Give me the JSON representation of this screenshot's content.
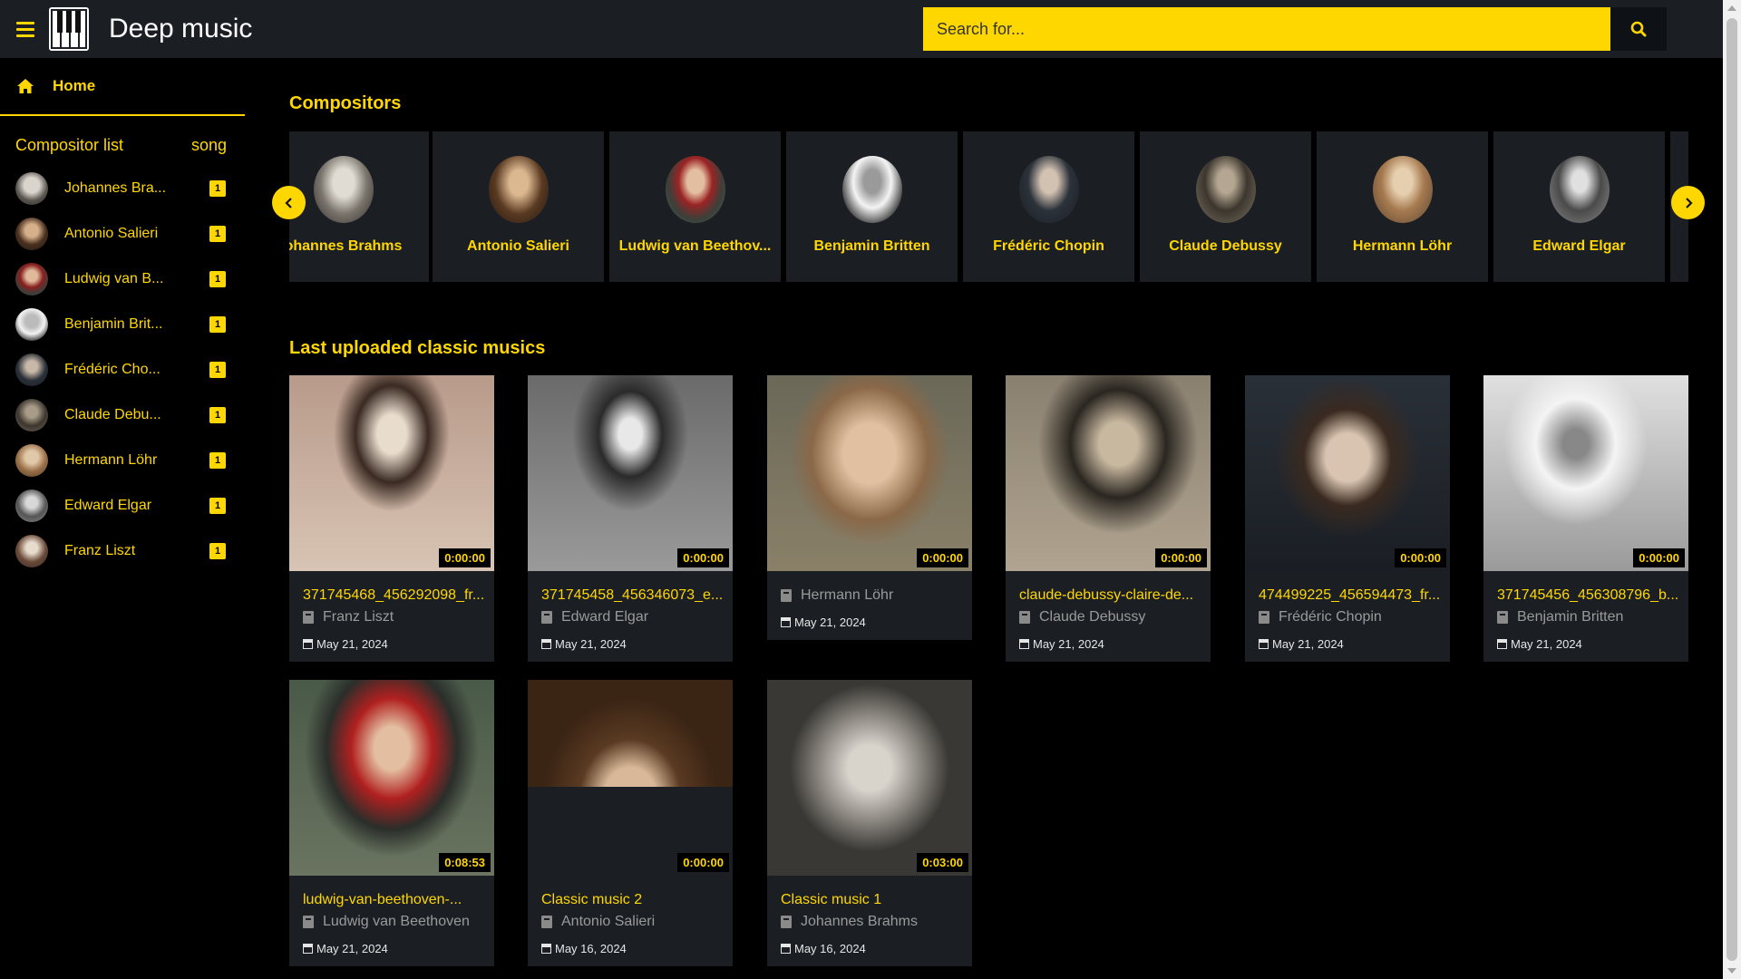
{
  "app": {
    "title": "Deep music"
  },
  "search": {
    "placeholder": "Search for..."
  },
  "sidebar": {
    "home_label": "Home",
    "list_title": "Compositor list",
    "count_title": "song",
    "items": [
      {
        "label": "Johannes Bra...",
        "count": "1"
      },
      {
        "label": "Antonio Salieri",
        "count": "1"
      },
      {
        "label": "Ludwig van B...",
        "count": "1"
      },
      {
        "label": "Benjamin Brit...",
        "count": "1"
      },
      {
        "label": "Frédéric Cho...",
        "count": "1"
      },
      {
        "label": "Claude Debu...",
        "count": "1"
      },
      {
        "label": "Hermann Löhr",
        "count": "1"
      },
      {
        "label": "Edward Elgar",
        "count": "1"
      },
      {
        "label": "Franz Liszt",
        "count": "1"
      }
    ]
  },
  "compositors": {
    "title": "Compositors",
    "items": [
      {
        "name": "ohannes Brahms"
      },
      {
        "name": "Antonio Salieri"
      },
      {
        "name": "Ludwig van Beethov..."
      },
      {
        "name": "Benjamin Britten"
      },
      {
        "name": "Frédéric Chopin"
      },
      {
        "name": "Claude Debussy"
      },
      {
        "name": "Hermann Löhr"
      },
      {
        "name": "Edward Elgar"
      }
    ]
  },
  "latest": {
    "title": "Last uploaded classic musics",
    "items": [
      {
        "title": "371745468_456292098_fr...",
        "composer": "Franz Liszt",
        "date": "May 21, 2024",
        "duration": "0:00:00"
      },
      {
        "title": "371745458_456346073_e...",
        "composer": "Edward Elgar",
        "date": "May 21, 2024",
        "duration": "0:00:00"
      },
      {
        "title": "",
        "composer": "Hermann Löhr",
        "date": "May 21, 2024",
        "duration": "0:00:00"
      },
      {
        "title": "claude-debussy-claire-de...",
        "composer": "Claude Debussy",
        "date": "May 21, 2024",
        "duration": "0:00:00"
      },
      {
        "title": "474499225_456594473_fr...",
        "composer": "Frédéric Chopin",
        "date": "May 21, 2024",
        "duration": "0:00:00"
      },
      {
        "title": "371745456_456308796_b...",
        "composer": "Benjamin Britten",
        "date": "May 21, 2024",
        "duration": "0:00:00"
      },
      {
        "title": "ludwig-van-beethoven-...",
        "composer": "Ludwig van Beethoven",
        "date": "May 21, 2024",
        "duration": "0:08:53"
      },
      {
        "title": "Classic music 2",
        "composer": "Antonio Salieri",
        "date": "May 16, 2024",
        "duration": "0:00:00"
      },
      {
        "title": "Classic music 1",
        "composer": "Johannes Brahms",
        "date": "May 16, 2024",
        "duration": "0:03:00"
      }
    ]
  },
  "colors": {
    "accent": "#ffd700",
    "panel": "#1b1f24",
    "background": "#000000"
  },
  "icons": [
    "menu-icon",
    "piano-logo-icon",
    "search-icon",
    "home-icon",
    "chevron-left-icon",
    "chevron-right-icon",
    "book-icon",
    "calendar-icon"
  ]
}
